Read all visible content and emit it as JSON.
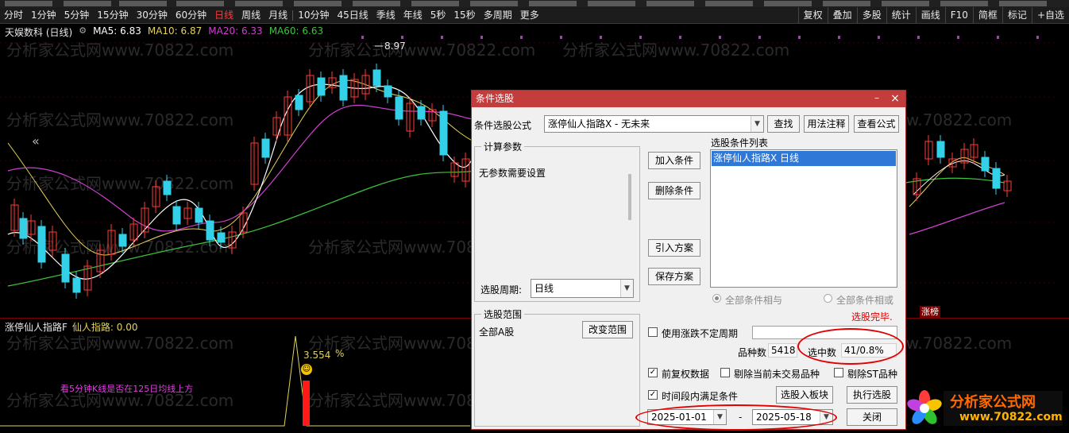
{
  "toolbar": {
    "periods": [
      "分时",
      "1分钟",
      "5分钟",
      "15分钟",
      "30分钟",
      "60分钟",
      "日线",
      "周线",
      "月线",
      "10分钟",
      "45日线",
      "季线",
      "年线",
      "5秒",
      "15秒",
      "多周期",
      "更多"
    ],
    "active_period": "日线",
    "tools": [
      "复权",
      "叠加",
      "多股",
      "统计",
      "画线",
      "F10",
      "简框",
      "标记",
      "+自选"
    ]
  },
  "main_chart": {
    "stock": "天娱数科 (日线)",
    "ma5": "MA5: 6.83",
    "ma10": "MA10: 6.87",
    "ma20": "MA20: 6.33",
    "ma60": "MA60: 6.63",
    "high_label": "8.97",
    "collapse_glyph": "«",
    "badge": "涨榜",
    "colors": {
      "up": "#ff3b3b",
      "down": "#33d0e8",
      "ma5": "#ffffff",
      "ma10": "#e6d25a",
      "ma20": "#d040d0",
      "ma60": "#3ec43e"
    }
  },
  "sub_chart": {
    "indicator": "涨停仙人指路F",
    "value": "仙人指路: 0.00",
    "peak_value": "3.554",
    "peak_unit": "%",
    "note": "看5分钟K线是否在125日均线上方"
  },
  "watermark": "分析家公式网www.70822.com",
  "dialog": {
    "title": "条件选股",
    "formula_label": "条件选股公式",
    "formula_value": "涨停仙人指路X  -  无未来",
    "find_btn": "查找",
    "usage_btn": "用法注释",
    "view_btn": "查看公式",
    "params_title": "计算参数",
    "params_text": "无参数需要设置",
    "add_btn": "加入条件",
    "delete_btn": "删除条件",
    "import_btn": "引入方案",
    "save_btn": "保存方案",
    "list_title": "选股条件列表",
    "list_items": [
      "涨停仙人指路X  日线"
    ],
    "period_label": "选股周期:",
    "period_value": "日线",
    "radio_and": "全部条件相与",
    "radio_or": "全部条件相或",
    "done_text": "选股完毕.",
    "range_title": "选股范围",
    "range_value": "全部A股",
    "change_range_btn": "改变范围",
    "chk_unfixed": "使用涨跌不定周期",
    "count_label": "品种数",
    "count_value": "5418",
    "selected_label": "选中数",
    "selected_value": "41/0.8%",
    "chk_fq": "前复权数据",
    "chk_exclude_untraded": "剔除当前未交易品种",
    "chk_exclude_st": "剔除ST品种",
    "chk_period": "时间段内满足条件",
    "to_board_btn": "选股入板块",
    "run_btn": "执行选股",
    "date_from": "2025-01-01",
    "date_dash": "-",
    "date_to": "2025-05-18",
    "close_btn": "关闭"
  },
  "logo": {
    "name": "分析家公式网",
    "url": "www.70822.com"
  }
}
